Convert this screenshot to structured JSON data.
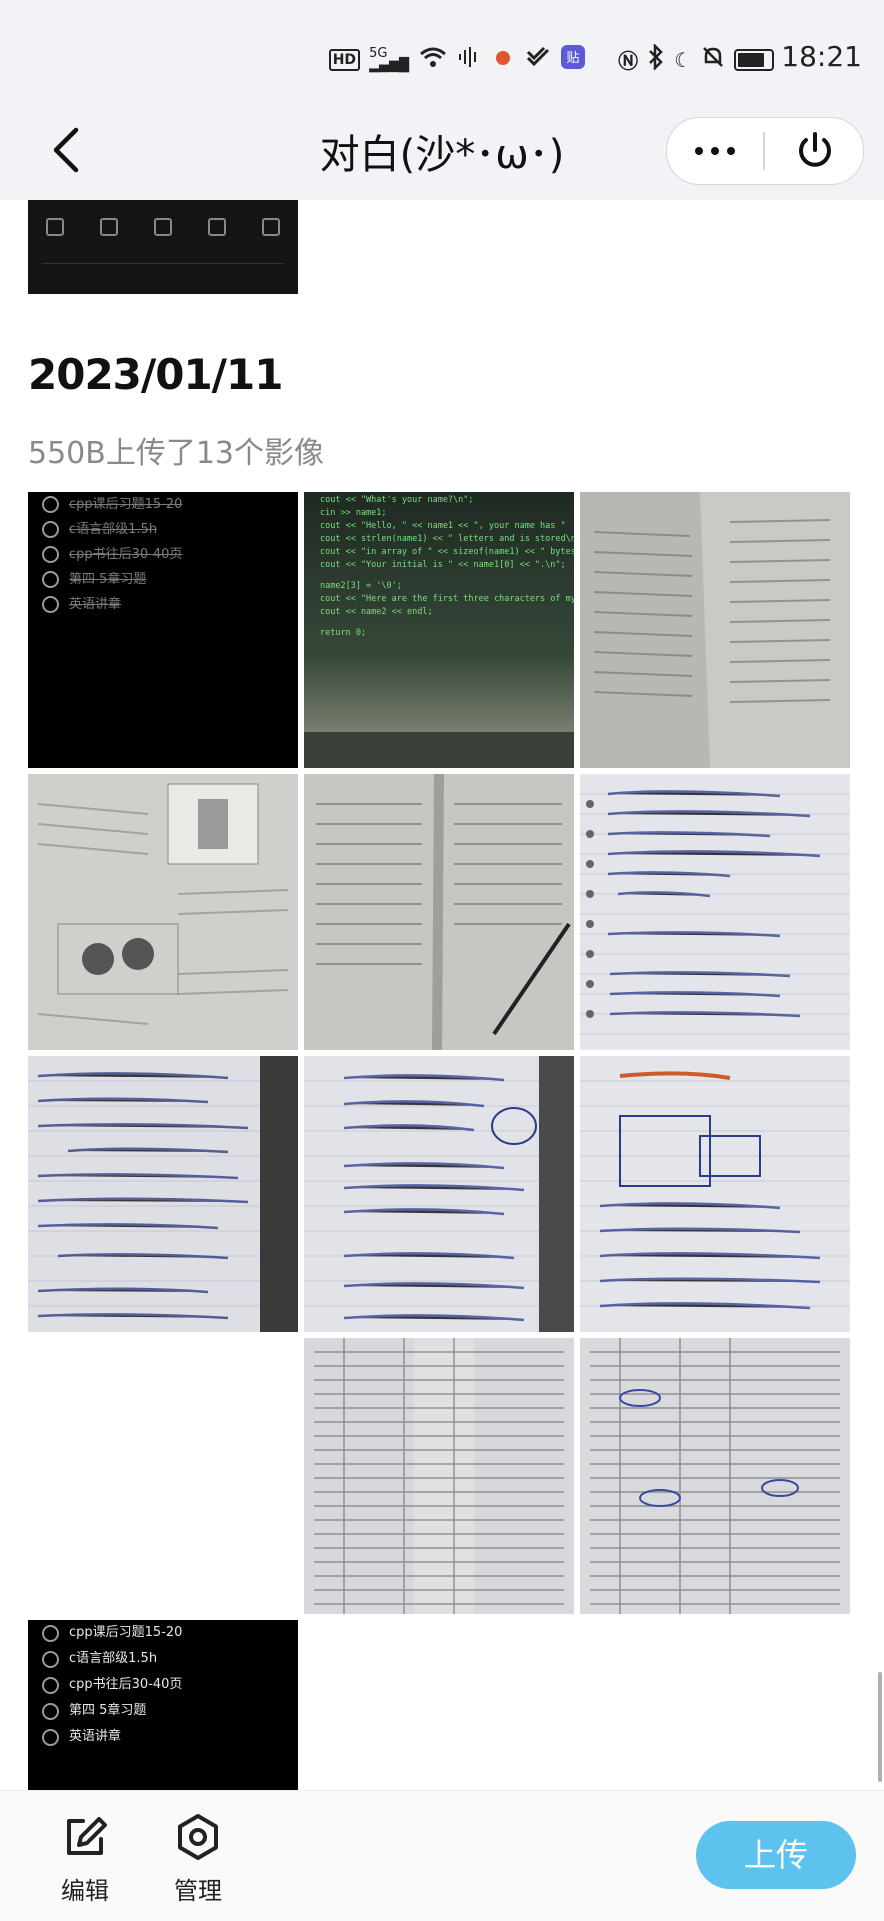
{
  "status_bar": {
    "hd": "HD",
    "network": "5G",
    "network2": "6",
    "time": "18:21",
    "icons": [
      "hd-icon",
      "signal-icon",
      "wifi-icon",
      "audio-icon",
      "app-icon",
      "sticker-icon",
      "nfc-icon",
      "bluetooth-icon",
      "moon-icon",
      "mute-icon",
      "battery-icon"
    ]
  },
  "navbar": {
    "title": "对白(沙*･ω･)",
    "back_icon": "chevron-left-icon",
    "more_icon": "more-dots-icon",
    "power_icon": "power-icon"
  },
  "section": {
    "date": "2023/01/11",
    "summary": "550B上传了13个影像"
  },
  "photo1_todos": [
    {
      "text": "cpp课后习题15-20",
      "done": true
    },
    {
      "text": "c语言部级1.5h",
      "done": true
    },
    {
      "text": "cpp书往后30-40页",
      "done": true
    },
    {
      "text": "第四 5章习题",
      "done": true
    },
    {
      "text": "英语讲章",
      "done": true
    }
  ],
  "code_lines": [
    "cout << \"What's your name?\\n\";",
    "cin >> name1;",
    "cout << \"Hello, \" << name1 << \", your name has \"",
    "cout << strlen(name1) << \" letters and is stored\\n\"",
    "cout << \"in array of \" << sizeof(name1) << \" bytes.\\n\"",
    "cout << \"Your initial is \" << name1[0] << \".\\n\";",
    "name2[3] = '\\0';",
    "cout << \"Here are the first three characters of my na\"",
    "cout << name2 << endl;",
    "return 0;"
  ],
  "last_todos": [
    {
      "text": "cpp课后习题15-20"
    },
    {
      "text": "c语言部级1.5h"
    },
    {
      "text": "cpp书往后30-40页"
    },
    {
      "text": "第四 5章习题"
    },
    {
      "text": "英语讲章"
    }
  ],
  "bottom_bar": {
    "edit_label": "编辑",
    "edit_icon": "edit-icon",
    "manage_label": "管理",
    "manage_icon": "settings-icon",
    "upload_label": "上传",
    "upload_color": "#5ec2ef"
  }
}
